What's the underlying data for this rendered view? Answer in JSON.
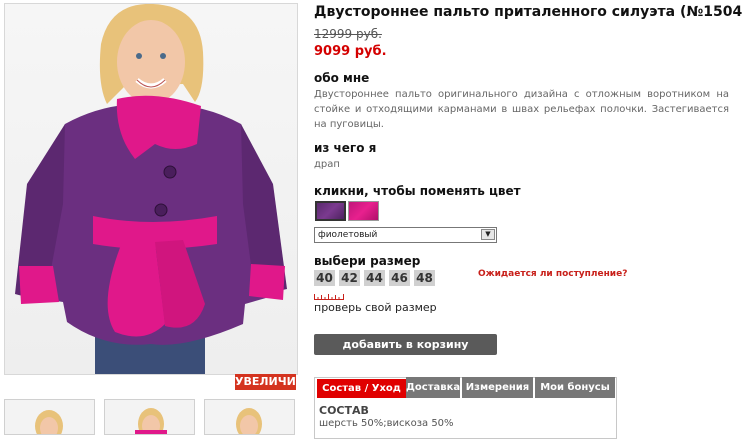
{
  "product": {
    "title": "Двустороннее пальто приталенного силуэта (№1504)",
    "old_price": "12999 руб.",
    "new_price": "9099 руб."
  },
  "gallery": {
    "zoom_label": "УВЕЛИЧИТЬ",
    "thumbnails": 3
  },
  "about": {
    "heading": "обо мне",
    "text": "Двустороннее пальто оригинального дизайна с отложным воротником на стойке и отходящими карманами в швах рельефах полочки. Застегивается на пуговицы."
  },
  "material": {
    "heading": "из чего я",
    "value": "драп"
  },
  "color": {
    "heading": "кликни, чтобы поменять цвет",
    "swatches": [
      "#6b2f80",
      "#e0188a"
    ],
    "selected": "фиолетовый"
  },
  "size": {
    "heading": "выбери размер",
    "options": [
      "40",
      "42",
      "44",
      "46",
      "48"
    ],
    "expected_link": "Ожидается ли поступление?",
    "check_size": "проверь свой размер"
  },
  "cart": {
    "add_label": "добавить в корзину"
  },
  "tabs": {
    "items": [
      "Состав / Уход",
      "Доставка",
      "Измерения",
      "Мои бонусы"
    ],
    "active": 0
  },
  "composition": {
    "heading": "СОСТАВ",
    "value": "шерсть 50%;вискоза 50%"
  },
  "colors": {
    "accent_red": "#e00000",
    "price_red": "#d40000",
    "coat_purple": "#6b2f80",
    "coat_pink": "#e0188a"
  }
}
